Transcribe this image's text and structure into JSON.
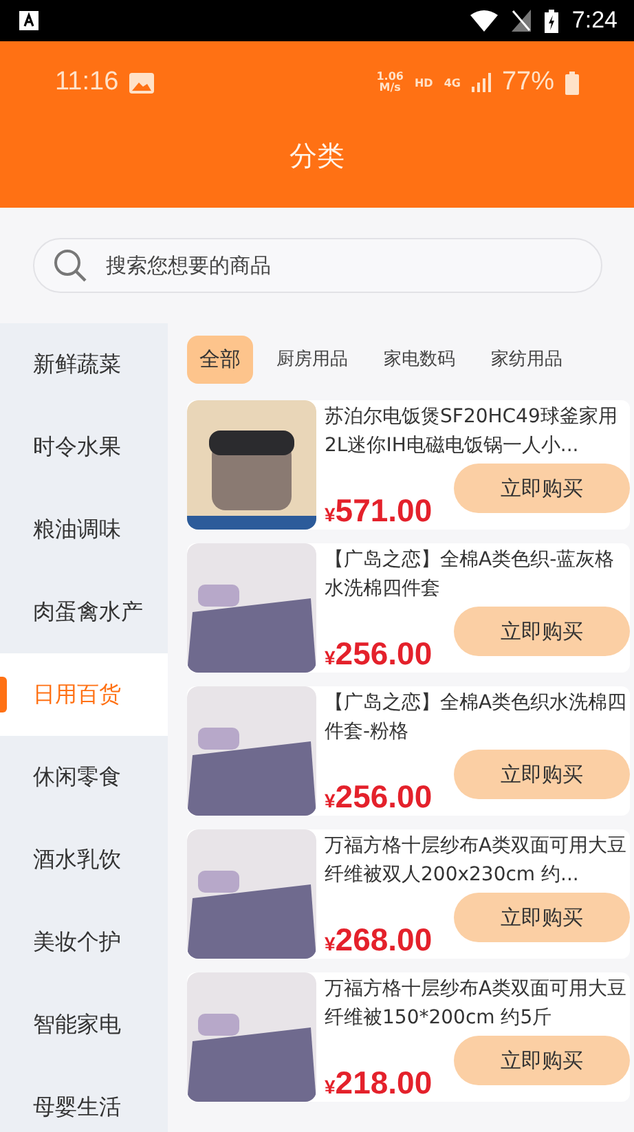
{
  "system_bar": {
    "time": "7:24"
  },
  "header": {
    "status": {
      "time": "11:16",
      "speed_value": "1.06",
      "speed_unit": "M/s",
      "hd": "HD",
      "network": "4G",
      "battery": "77%"
    },
    "title": "分类"
  },
  "search": {
    "placeholder": "搜索您想要的商品"
  },
  "sidebar": {
    "items": [
      {
        "label": "新鲜蔬菜",
        "selected": false
      },
      {
        "label": "时令水果",
        "selected": false
      },
      {
        "label": "粮油调味",
        "selected": false
      },
      {
        "label": "肉蛋禽水产",
        "selected": false
      },
      {
        "label": "日用百货",
        "selected": true
      },
      {
        "label": "休闲零食",
        "selected": false
      },
      {
        "label": "酒水乳饮",
        "selected": false
      },
      {
        "label": "美妆个护",
        "selected": false
      },
      {
        "label": "智能家电",
        "selected": false
      },
      {
        "label": "母婴生活",
        "selected": false
      }
    ]
  },
  "tabs": [
    {
      "label": "全部",
      "selected": true
    },
    {
      "label": "厨房用品",
      "selected": false
    },
    {
      "label": "家电数码",
      "selected": false
    },
    {
      "label": "家纺用品",
      "selected": false
    }
  ],
  "products": [
    {
      "title": "苏泊尔电饭煲SF20HC49球釜家用2L迷你IH电磁电饭锅一人小...",
      "currency": "¥",
      "price": "571.00",
      "button": "立即购买",
      "kind": "cooker"
    },
    {
      "title": "【广岛之恋】全棉A类色织-蓝灰格水洗棉四件套",
      "currency": "¥",
      "price": "256.00",
      "button": "立即购买",
      "kind": "bedding"
    },
    {
      "title": "【广岛之恋】全棉A类色织水洗棉四件套-粉格",
      "currency": "¥",
      "price": "256.00",
      "button": "立即购买",
      "kind": "bedding"
    },
    {
      "title": "万福方格十层纱布A类双面可用大豆纤维被双人200x230cm 约...",
      "currency": "¥",
      "price": "268.00",
      "button": "立即购买",
      "kind": "bedding"
    },
    {
      "title": "万福方格十层纱布A类双面可用大豆纤维被150*200cm 约5斤",
      "currency": "¥",
      "price": "218.00",
      "button": "立即购买",
      "kind": "bedding"
    }
  ]
}
